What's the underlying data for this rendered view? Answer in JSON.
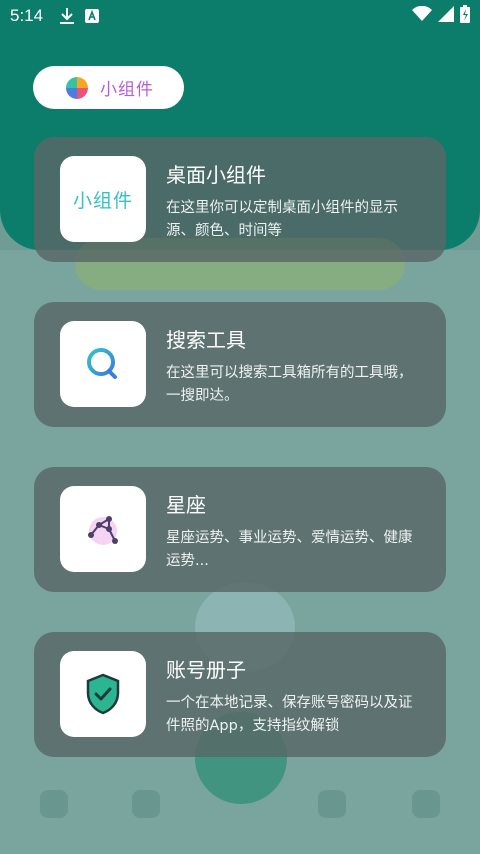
{
  "status_bar": {
    "time": "5:14",
    "icons": [
      "download-icon",
      "a-badge-icon",
      "wifi-icon",
      "signal-icon",
      "battery-charging-icon"
    ]
  },
  "header": {
    "title": "小组件"
  },
  "cards": [
    {
      "title": "桌面小组件",
      "description": "在这里你可以定制桌面小组件的显示源、颜色、时间等",
      "icon_text": "小组件",
      "icon": "widget-icon"
    },
    {
      "title": "搜索工具",
      "description": "在这里可以搜索工具箱所有的工具哦，一搜即达。",
      "icon": "search-icon"
    },
    {
      "title": "星座",
      "description": "星座运势、事业运势、爱情运势、健康运势...",
      "icon": "constellation-icon"
    },
    {
      "title": "账号册子",
      "description": "一个在本地记录、保存账号密码以及证件照的App，支持指纹解锁",
      "icon": "shield-check-icon"
    }
  ],
  "colors": {
    "background_top": "#0d7d6b",
    "card_background": "#586866",
    "header_accent": "#b85bd8",
    "widget_text": "#35c0c6"
  }
}
